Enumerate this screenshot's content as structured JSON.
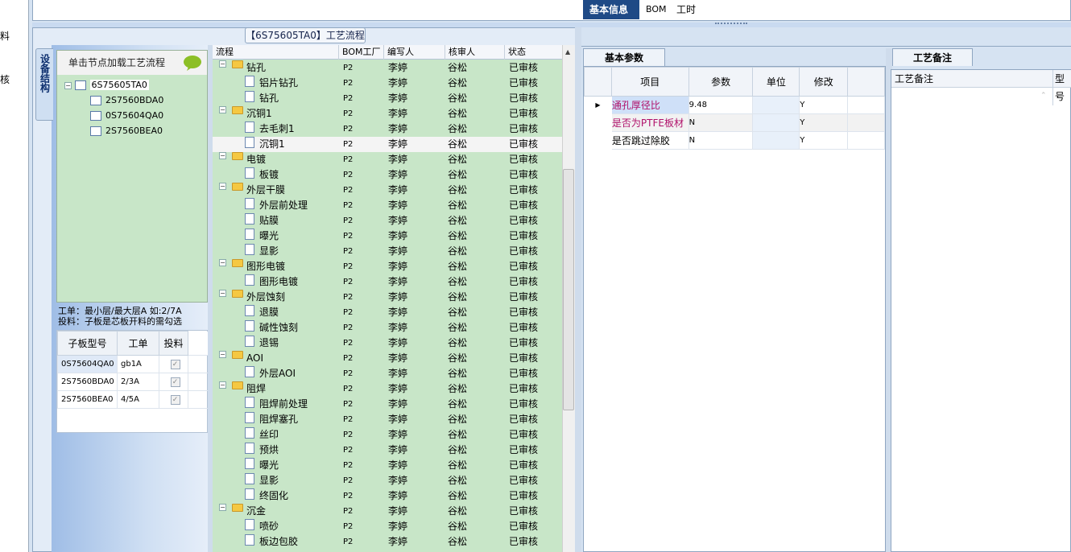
{
  "left_fragments": [
    "料",
    "核"
  ],
  "flow_panel": {
    "tab_title": "【6S75605TA0】工艺流程"
  },
  "side_tab": {
    "label": "设备结构"
  },
  "tree": {
    "title": "单击节点加载工艺流程",
    "root": "6S75605TA0",
    "children": [
      "2S7560BDA0",
      "0S75604QA0",
      "2S7560BEA0"
    ]
  },
  "notes": {
    "line1": "工单：最小层/最大层A 如:2/7A",
    "line2": "投料：子板是芯板开料的需勾选"
  },
  "sub_table": {
    "headers": [
      "子板型号",
      "工单",
      "投料"
    ],
    "rows": [
      {
        "model": "0S75604QA0",
        "order": "gb1A",
        "checked": true
      },
      {
        "model": "2S7560BDA0",
        "order": "2/3A",
        "checked": true
      },
      {
        "model": "2S7560BEA0",
        "order": "4/5A",
        "checked": true
      }
    ]
  },
  "flow_grid": {
    "headers": [
      "流程",
      "BOM工厂",
      "编写人",
      "核审人",
      "状态"
    ],
    "rows": [
      {
        "name": "钻孔",
        "type": "folder",
        "bom": "P2",
        "author": "李婷",
        "reviewer": "谷松",
        "status": "已审核"
      },
      {
        "name": "铝片钻孔",
        "type": "doc",
        "bom": "P2",
        "author": "李婷",
        "reviewer": "谷松",
        "status": "已审核"
      },
      {
        "name": "钻孔",
        "type": "doc",
        "bom": "P2",
        "author": "李婷",
        "reviewer": "谷松",
        "status": "已审核"
      },
      {
        "name": "沉铜1",
        "type": "folder",
        "bom": "P2",
        "author": "李婷",
        "reviewer": "谷松",
        "status": "已审核"
      },
      {
        "name": "去毛刺1",
        "type": "doc",
        "bom": "P2",
        "author": "李婷",
        "reviewer": "谷松",
        "status": "已审核"
      },
      {
        "name": "沉铜1",
        "type": "doc",
        "bom": "P2",
        "author": "李婷",
        "reviewer": "谷松",
        "status": "已审核",
        "selected": true
      },
      {
        "name": "电镀",
        "type": "folder",
        "bom": "P2",
        "author": "李婷",
        "reviewer": "谷松",
        "status": "已审核"
      },
      {
        "name": "板镀",
        "type": "doc",
        "bom": "P2",
        "author": "李婷",
        "reviewer": "谷松",
        "status": "已审核"
      },
      {
        "name": "外层干膜",
        "type": "folder",
        "bom": "P2",
        "author": "李婷",
        "reviewer": "谷松",
        "status": "已审核"
      },
      {
        "name": "外层前处理",
        "type": "doc",
        "bom": "P2",
        "author": "李婷",
        "reviewer": "谷松",
        "status": "已审核"
      },
      {
        "name": "贴膜",
        "type": "doc",
        "bom": "P2",
        "author": "李婷",
        "reviewer": "谷松",
        "status": "已审核"
      },
      {
        "name": "曝光",
        "type": "doc",
        "bom": "P2",
        "author": "李婷",
        "reviewer": "谷松",
        "status": "已审核"
      },
      {
        "name": "显影",
        "type": "doc",
        "bom": "P2",
        "author": "李婷",
        "reviewer": "谷松",
        "status": "已审核"
      },
      {
        "name": "图形电镀",
        "type": "folder",
        "bom": "P2",
        "author": "李婷",
        "reviewer": "谷松",
        "status": "已审核"
      },
      {
        "name": "图形电镀",
        "type": "doc",
        "bom": "P2",
        "author": "李婷",
        "reviewer": "谷松",
        "status": "已审核"
      },
      {
        "name": "外层蚀刻",
        "type": "folder",
        "bom": "P2",
        "author": "李婷",
        "reviewer": "谷松",
        "status": "已审核"
      },
      {
        "name": "退膜",
        "type": "doc",
        "bom": "P2",
        "author": "李婷",
        "reviewer": "谷松",
        "status": "已审核"
      },
      {
        "name": "碱性蚀刻",
        "type": "doc",
        "bom": "P2",
        "author": "李婷",
        "reviewer": "谷松",
        "status": "已审核"
      },
      {
        "name": "退锡",
        "type": "doc",
        "bom": "P2",
        "author": "李婷",
        "reviewer": "谷松",
        "status": "已审核"
      },
      {
        "name": "AOI",
        "type": "folder",
        "bom": "P2",
        "author": "李婷",
        "reviewer": "谷松",
        "status": "已审核"
      },
      {
        "name": "外层AOI",
        "type": "doc",
        "bom": "P2",
        "author": "李婷",
        "reviewer": "谷松",
        "status": "已审核"
      },
      {
        "name": "阻焊",
        "type": "folder",
        "bom": "P2",
        "author": "李婷",
        "reviewer": "谷松",
        "status": "已审核"
      },
      {
        "name": "阻焊前处理",
        "type": "doc",
        "bom": "P2",
        "author": "李婷",
        "reviewer": "谷松",
        "status": "已审核"
      },
      {
        "name": "阻焊塞孔",
        "type": "doc",
        "bom": "P2",
        "author": "李婷",
        "reviewer": "谷松",
        "status": "已审核"
      },
      {
        "name": "丝印",
        "type": "doc",
        "bom": "P2",
        "author": "李婷",
        "reviewer": "谷松",
        "status": "已审核"
      },
      {
        "name": "预烘",
        "type": "doc",
        "bom": "P2",
        "author": "李婷",
        "reviewer": "谷松",
        "status": "已审核"
      },
      {
        "name": "曝光",
        "type": "doc",
        "bom": "P2",
        "author": "李婷",
        "reviewer": "谷松",
        "status": "已审核"
      },
      {
        "name": "显影",
        "type": "doc",
        "bom": "P2",
        "author": "李婷",
        "reviewer": "谷松",
        "status": "已审核"
      },
      {
        "name": "终固化",
        "type": "doc",
        "bom": "P2",
        "author": "李婷",
        "reviewer": "谷松",
        "status": "已审核"
      },
      {
        "name": "沉金",
        "type": "folder",
        "bom": "P2",
        "author": "李婷",
        "reviewer": "谷松",
        "status": "已审核"
      },
      {
        "name": "喷砂",
        "type": "doc",
        "bom": "P2",
        "author": "李婷",
        "reviewer": "谷松",
        "status": "已审核"
      },
      {
        "name": "板边包胶",
        "type": "doc",
        "bom": "P2",
        "author": "李婷",
        "reviewer": "谷松",
        "status": "已审核"
      }
    ]
  },
  "right_tabs": [
    "基本信息",
    "BOM",
    "工时"
  ],
  "basic_params": {
    "tab": "基本参数",
    "headers": [
      "项目",
      "参数",
      "单位",
      "修改"
    ],
    "rows": [
      {
        "item": "通孔厚径比",
        "value": "9.48",
        "unit": "",
        "modify": "Y",
        "highlight": true
      },
      {
        "item": "是否为PTFE板材",
        "value": "N",
        "unit": "",
        "modify": "Y",
        "highlight": true
      },
      {
        "item": "是否跳过除胶",
        "value": "N",
        "unit": "",
        "modify": "Y",
        "highlight": false
      }
    ]
  },
  "process_notes": {
    "tab": "工艺备注",
    "headers": [
      "工艺备注",
      "型号"
    ]
  },
  "colors": {
    "tree_green": "#c8e6c8",
    "accent_blue": "#1f4a86",
    "highlight_text": "#b0106a",
    "highlight_cell": "#cfe0f8"
  }
}
